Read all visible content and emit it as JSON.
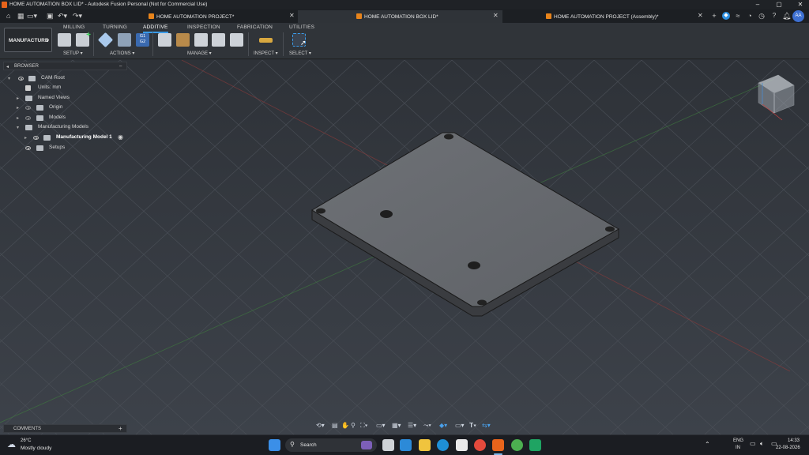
{
  "window": {
    "title": "HOME AUTOMATION BOX LID* - Autodesk Fusion Personal (Not for Commercial Use)",
    "controls": [
      "–",
      "▢",
      "✕"
    ]
  },
  "tabs": [
    {
      "label": "HOME AUTOMATION PROJECT*"
    },
    {
      "label": "HOME AUTOMATION BOX LID*"
    },
    {
      "label": "HOME AUTOMATION PROJECT (Assembly)*"
    }
  ],
  "user": {
    "initials": "AA"
  },
  "ribbon": {
    "workspace": "MANUFACTURE",
    "tabs": [
      "MILLING",
      "TURNING",
      "ADDITIVE",
      "INSPECTION",
      "FABRICATION",
      "UTILITIES"
    ],
    "groups": [
      "SETUP ▾",
      "ACTIONS ▾",
      "MANAGE ▾",
      "INSPECT ▾",
      "SELECT ▾"
    ],
    "gcode_icon": "G1\nG2"
  },
  "browser": {
    "title": "BROWSER",
    "items": [
      {
        "label": "CAM Root"
      },
      {
        "label": "Units: mm"
      },
      {
        "label": "Named Views"
      },
      {
        "label": "Origin"
      },
      {
        "label": "Models"
      },
      {
        "label": "Manufacturing Models"
      },
      {
        "label": "Manufacturing Model 1"
      },
      {
        "label": "Setups"
      }
    ]
  },
  "comments": {
    "title": "COMMENTS"
  },
  "taskbar": {
    "weather_temp": "26°C",
    "weather_desc": "Mostly cloudy",
    "search_label": "Search",
    "lang_top": "ENG",
    "lang_bottom": "IN",
    "time": "14:33",
    "date": "22-08-2026"
  },
  "colors": {
    "accent": "#3a9be8",
    "fusion_orange": "#e8641b",
    "viewport_bg": "#2b2f35"
  }
}
